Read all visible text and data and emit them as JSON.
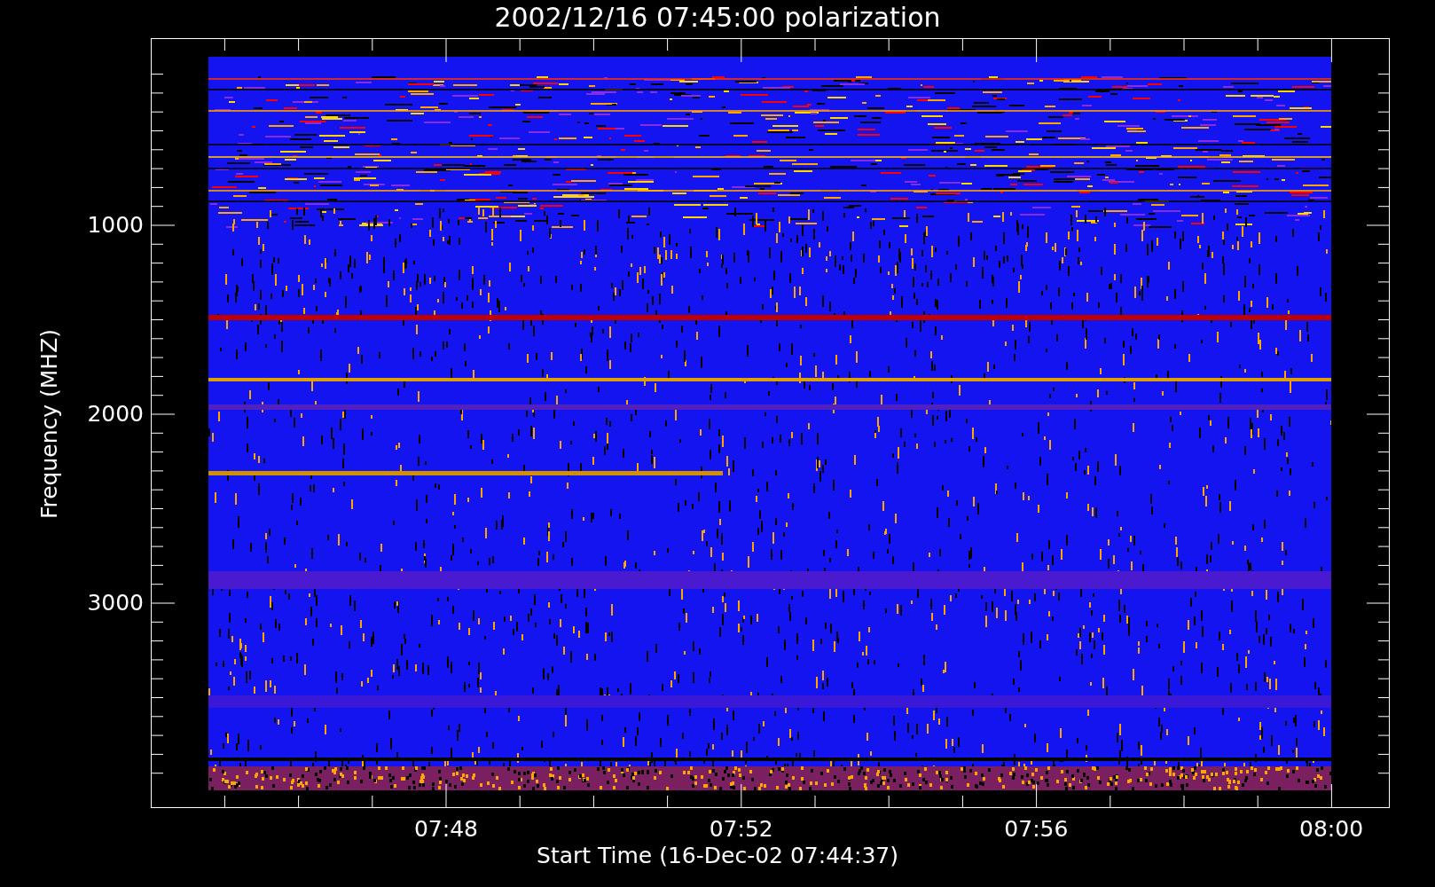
{
  "plot": {
    "title": "2002/12/16 07:45:00 polarization",
    "ylabel": "Frequency (MHZ)",
    "xlabel": "Start Time (16-Dec-02 07:44:37)",
    "yticks": [
      "1000",
      "2000",
      "3000"
    ],
    "xticks": [
      "07:48",
      "07:52",
      "07:56",
      "08:00"
    ]
  }
}
